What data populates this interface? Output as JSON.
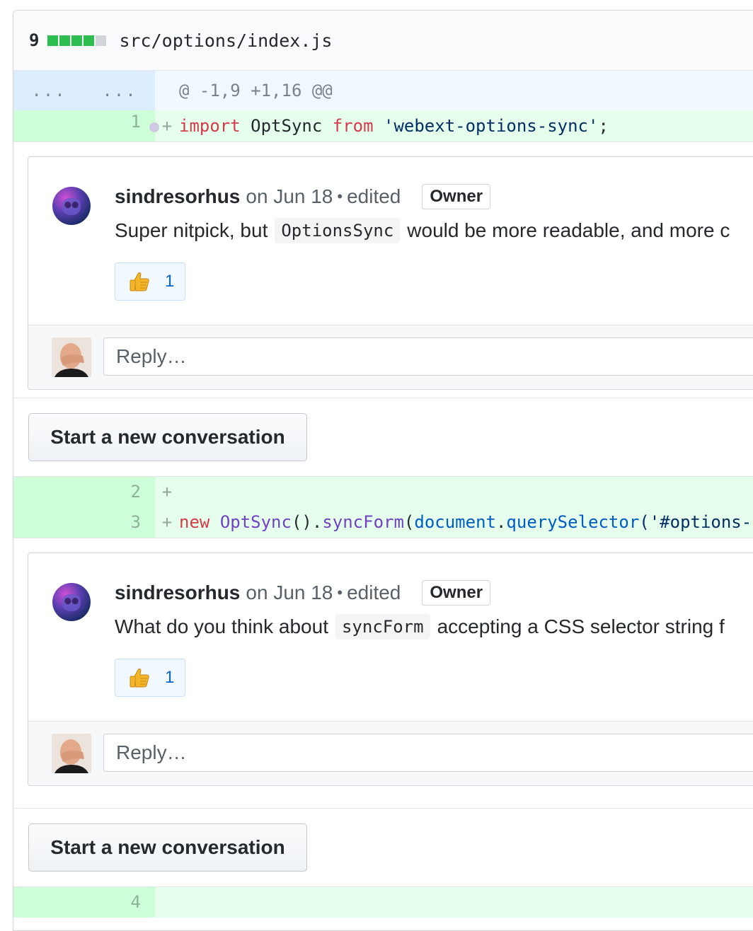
{
  "file": {
    "diffstat_count": "9",
    "diffstat_blocks": [
      "#2cbe4e",
      "#2cbe4e",
      "#2cbe4e",
      "#2cbe4e",
      "#d1d5da"
    ],
    "name": "src/options/index.js"
  },
  "hunk": {
    "old_marker": "...",
    "new_marker": "...",
    "header": "@ -1,9 +1,16 @@"
  },
  "lines": {
    "line1": {
      "num": "1",
      "tokens": [
        "import",
        " OptSync ",
        "from",
        " ",
        "'webext-options-sync'",
        ";"
      ]
    },
    "line2": {
      "num": "2"
    },
    "line3": {
      "num": "3",
      "tokens": [
        "new",
        " ",
        "OptSync",
        "().",
        "syncForm",
        "(",
        "document",
        ".",
        "querySelector",
        "('#options-"
      ]
    },
    "line4": {
      "num": "4"
    }
  },
  "plus_sign": "+",
  "comments": [
    {
      "author": "sindresorhus",
      "meta": "on Jun 18",
      "edited": "edited",
      "badge": "Owner",
      "text_before": "Super nitpick, but",
      "code": "OptionsSync",
      "text_after": "would be more readable, and more c",
      "reaction_count": "1",
      "reply_placeholder": "Reply…"
    },
    {
      "author": "sindresorhus",
      "meta": "on Jun 18",
      "edited": "edited",
      "badge": "Owner",
      "text_before": "What do you think about",
      "code": "syncForm",
      "text_after": "accepting a CSS selector string f",
      "reaction_count": "1",
      "reply_placeholder": "Reply…"
    }
  ],
  "conversation_button": "Start a new conversation",
  "colors": {
    "addition_bg": "#e6ffed",
    "addition_gutter": "#cdffd8",
    "hunk_bg": "#f1f8ff",
    "keyword": "#d73a49",
    "string": "#032f62",
    "function": "#6f42c1",
    "constant": "#005cc5",
    "link": "#0366d6"
  }
}
